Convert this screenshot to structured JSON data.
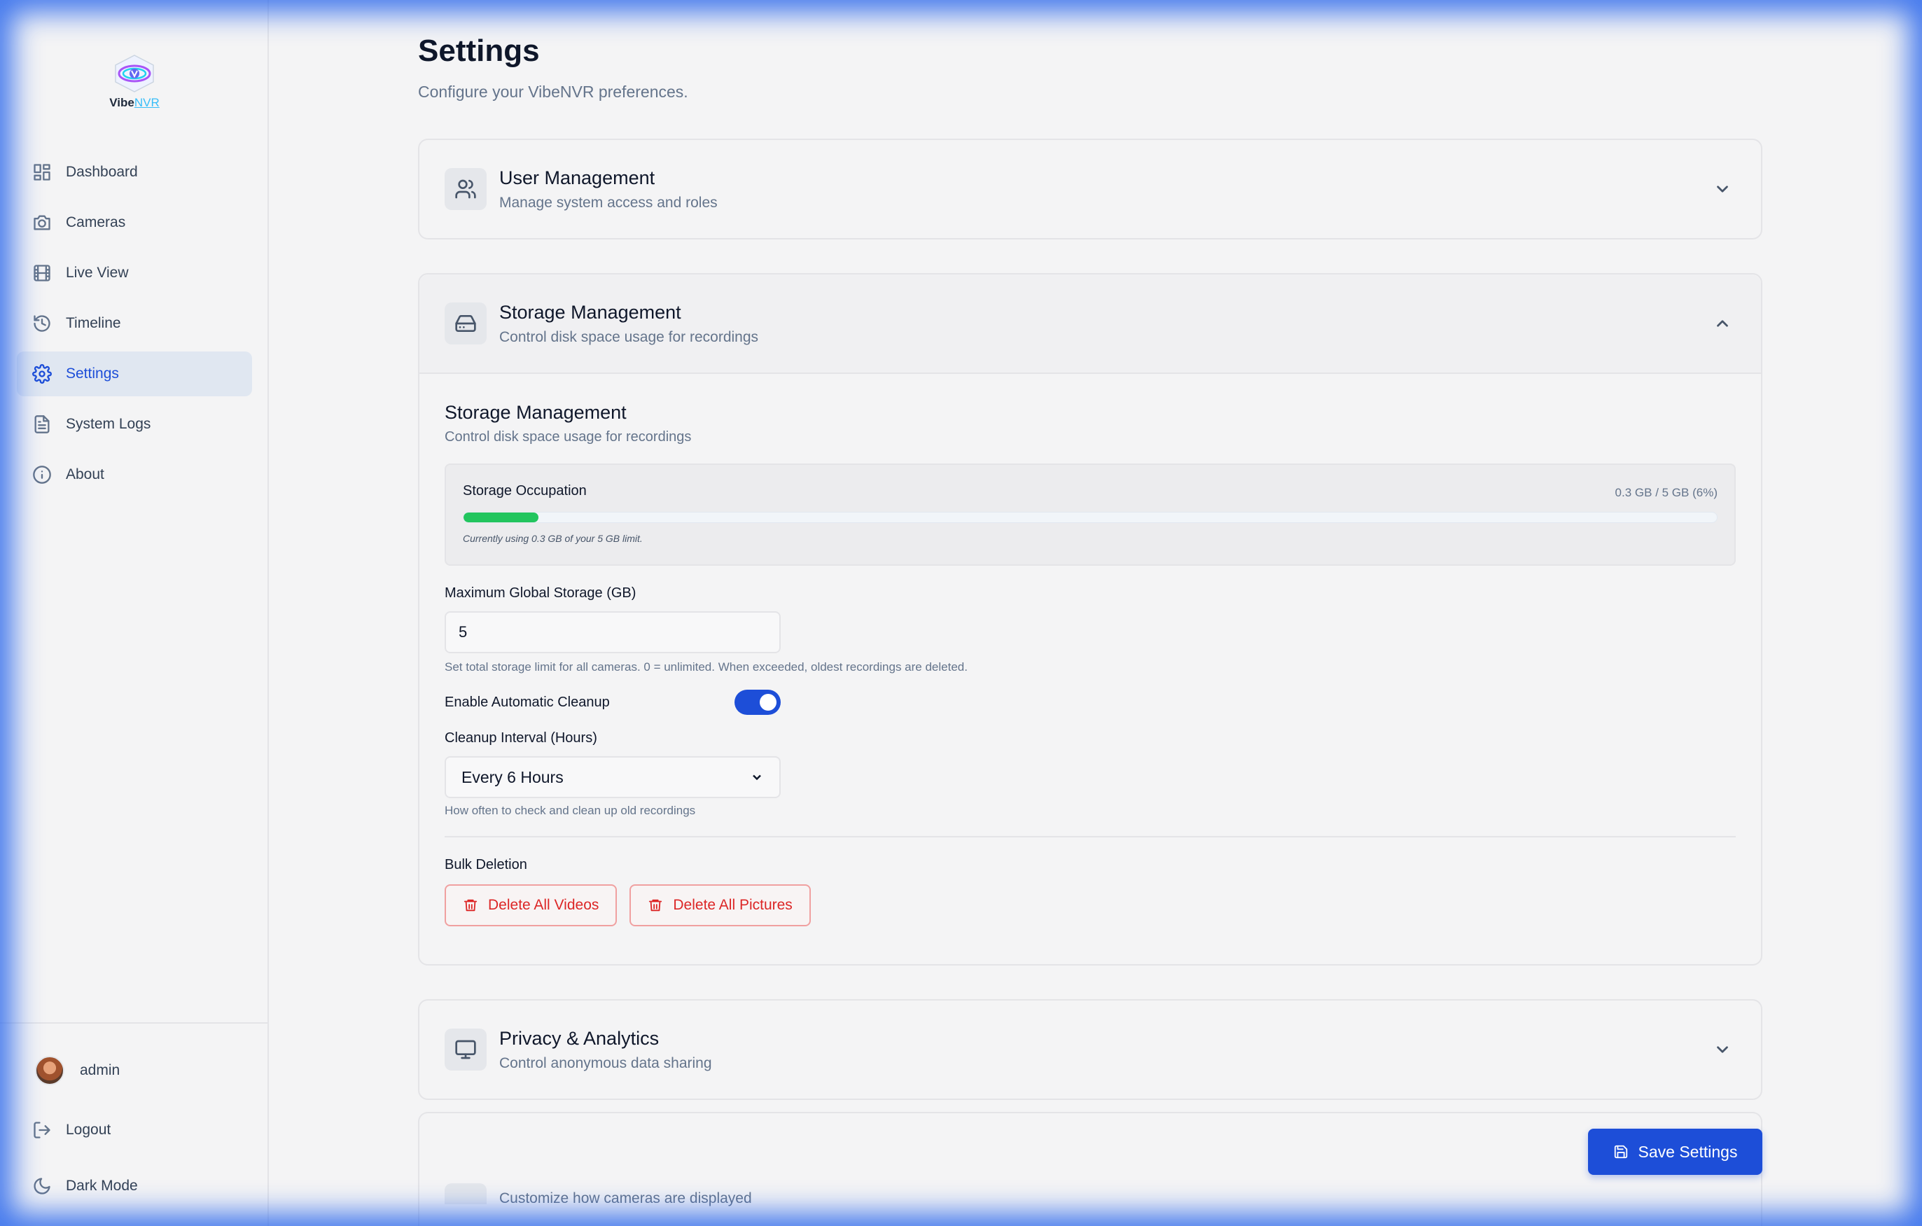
{
  "brand": {
    "name_main": "Vibe",
    "name_accent": "NVR"
  },
  "sidebar": {
    "items": [
      {
        "label": "Dashboard",
        "icon": "dashboard-icon"
      },
      {
        "label": "Cameras",
        "icon": "camera-icon"
      },
      {
        "label": "Live View",
        "icon": "film-icon"
      },
      {
        "label": "Timeline",
        "icon": "history-icon"
      },
      {
        "label": "Settings",
        "icon": "gear-icon",
        "active": true
      },
      {
        "label": "System Logs",
        "icon": "file-text-icon"
      },
      {
        "label": "About",
        "icon": "info-icon"
      }
    ],
    "user": "admin",
    "logout": "Logout",
    "dark_mode": "Dark Mode"
  },
  "page": {
    "title": "Settings",
    "subtitle": "Configure your VibeNVR preferences."
  },
  "user_management": {
    "title": "User Management",
    "desc": "Manage system access and roles"
  },
  "storage": {
    "title": "Storage Management",
    "desc": "Control disk space usage for recordings",
    "section_title": "Storage Management",
    "section_desc": "Control disk space usage for recordings",
    "occupation_label": "Storage Occupation",
    "occupation_value": "0.3 GB / 5 GB (6%)",
    "occupation_fraction": 0.06,
    "occupation_note": "Currently using 0.3 GB of your 5 GB limit.",
    "max_label": "Maximum Global Storage (GB)",
    "max_value": "5",
    "max_hint": "Set total storage limit for all cameras. 0 = unlimited. When exceeded, oldest recordings are deleted.",
    "cleanup_label": "Enable Automatic Cleanup",
    "cleanup_enabled": true,
    "interval_label": "Cleanup Interval (Hours)",
    "interval_value": "Every 6 Hours",
    "interval_hint": "How often to check and clean up old recordings",
    "bulk_label": "Bulk Deletion",
    "delete_videos": "Delete All Videos",
    "delete_pictures": "Delete All Pictures"
  },
  "privacy": {
    "title": "Privacy & Analytics",
    "desc": "Control anonymous data sharing"
  },
  "display": {
    "desc": "Customize how cameras are displayed"
  },
  "save_label": "Save Settings",
  "colors": {
    "accent": "#1d4ed8",
    "danger": "#dc2626",
    "progress": "#22c55e"
  }
}
